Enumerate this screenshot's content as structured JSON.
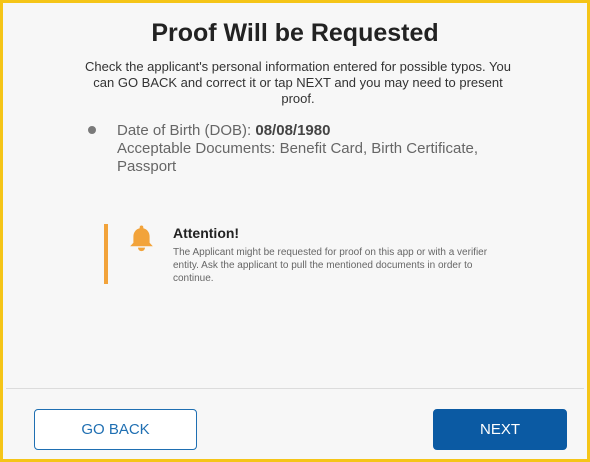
{
  "dialog": {
    "title": "Proof Will be Requested",
    "subtitle": "Check the applicant's personal information entered for possible typos. You can GO BACK and correct it or tap NEXT and you may need to present proof."
  },
  "details": {
    "dob_label": "Date of Birth (DOB): ",
    "dob_value": "08/08/1980",
    "documents_text": "Acceptable Documents: Benefit Card, Birth Certificate, Passport"
  },
  "attention": {
    "icon": "bell-icon",
    "title": "Attention!",
    "text": "The Applicant might be requested for proof on this app or with a verifier entity. Ask the applicant to pull the mentioned documents in order to continue."
  },
  "buttons": {
    "back_label": "GO BACK",
    "next_label": "NEXT"
  },
  "colors": {
    "border": "#f5c518",
    "accent": "#f2a33a",
    "primary": "#0b5aa3"
  }
}
